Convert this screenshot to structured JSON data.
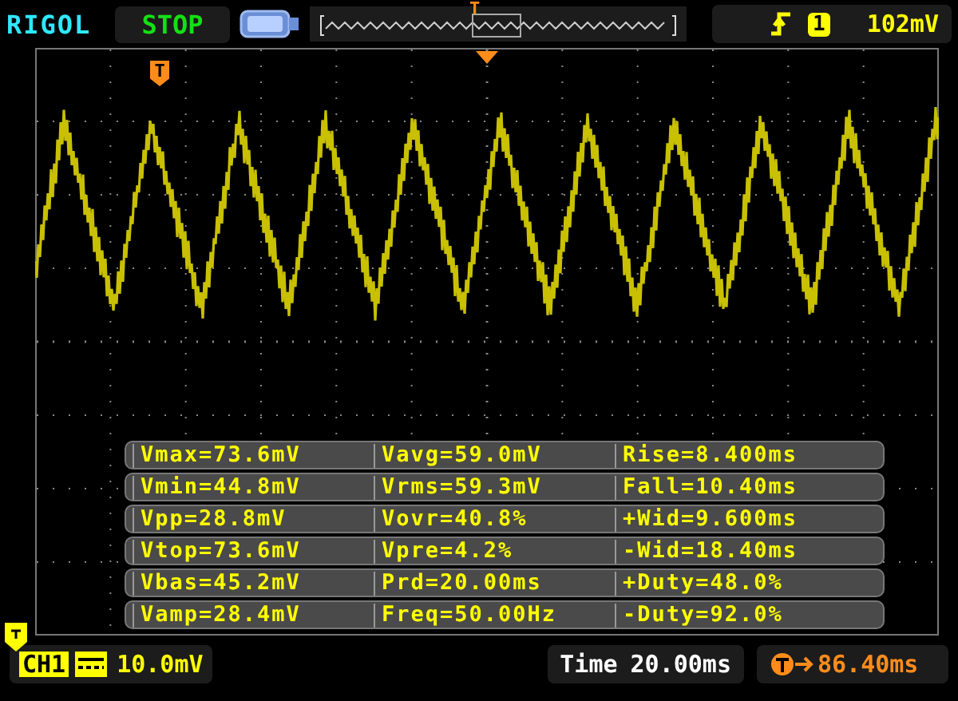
{
  "header": {
    "brand": "RIGOL",
    "run_state": "STOP",
    "memory_marker": "T",
    "trigger": {
      "source": "1",
      "level": "102mV"
    }
  },
  "screen": {
    "trigger_position_marker": "T"
  },
  "measurements": [
    [
      "Vmax=73.6mV",
      "Vavg=59.0mV",
      "Rise=8.400ms"
    ],
    [
      "Vmin=44.8mV",
      "Vrms=59.3mV",
      "Fall=10.40ms"
    ],
    [
      "Vpp=28.8mV",
      "Vovr=40.8%",
      "+Wid=9.600ms"
    ],
    [
      "Vtop=73.6mV",
      "Vpre=4.2%",
      "-Wid=18.40ms"
    ],
    [
      "Vbas=45.2mV",
      "Prd=20.00ms",
      "+Duty=48.0%"
    ],
    [
      "Vamp=28.4mV",
      "Freq=50.00Hz",
      "-Duty=92.0%"
    ]
  ],
  "footer": {
    "channel": "CH1",
    "scale": "10.0mV",
    "time_label": "Time",
    "timebase": "20.00ms",
    "trigger_offset": "86.40ms"
  }
}
